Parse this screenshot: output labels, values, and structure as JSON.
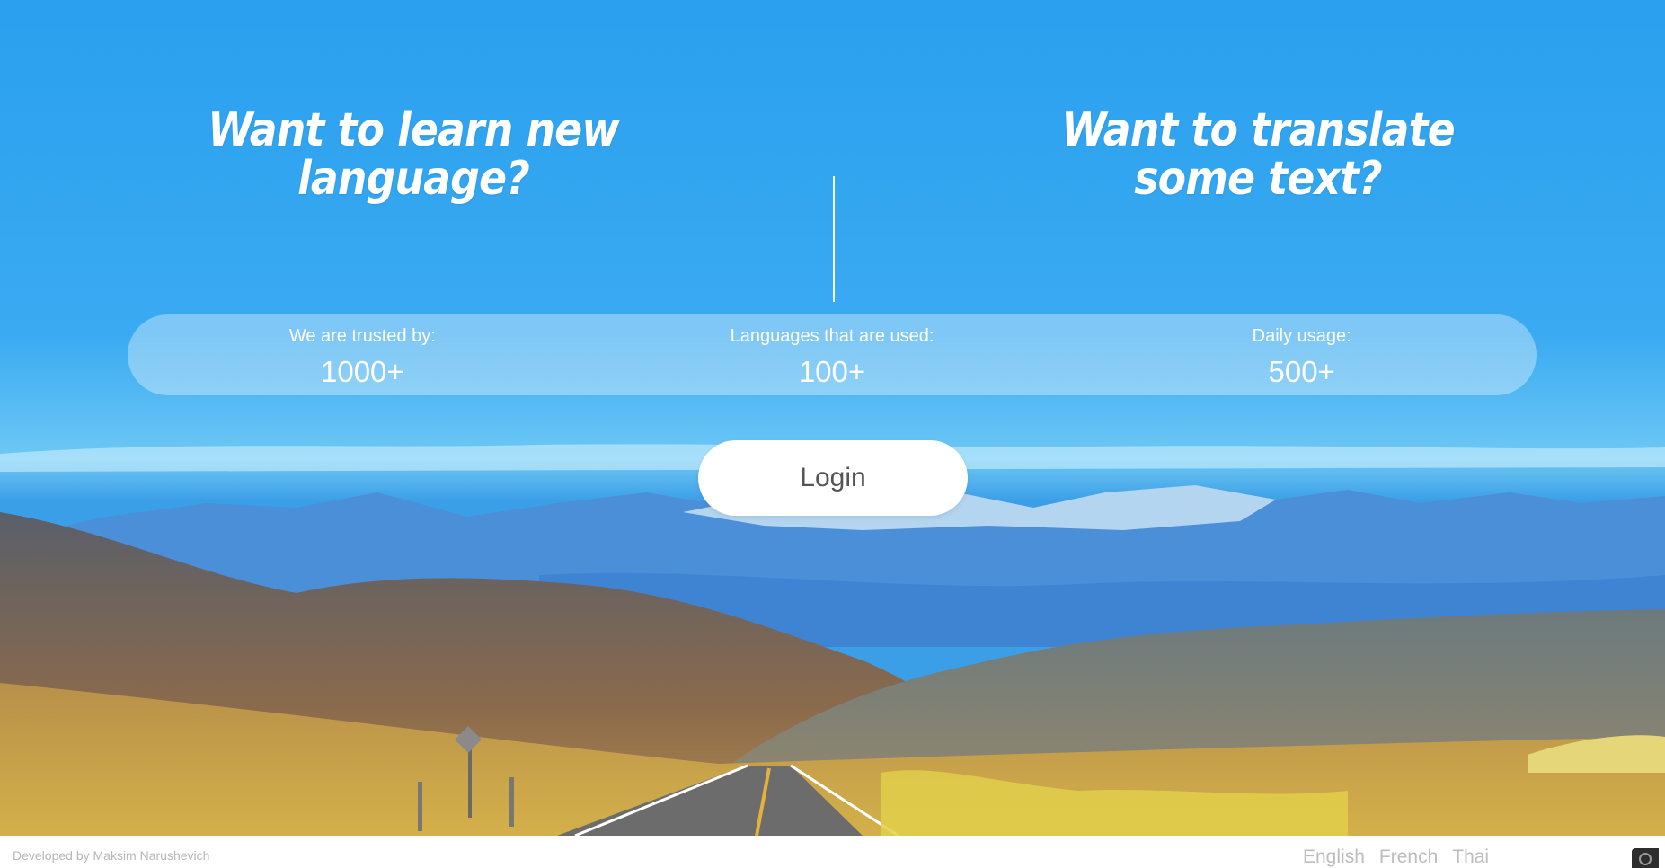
{
  "hero": {
    "left_headline": "Want to learn new language?",
    "right_headline": "Want to translate some text?"
  },
  "stats": [
    {
      "label": "We are trusted by:",
      "value": "1000+"
    },
    {
      "label": "Languages that are used:",
      "value": "100+"
    },
    {
      "label": "Daily usage:",
      "value": "500+"
    }
  ],
  "login": {
    "label": "Login"
  },
  "footer": {
    "credit": "Developed by Maksim Narushevich",
    "languages": [
      "English",
      "French",
      "Thai"
    ]
  }
}
